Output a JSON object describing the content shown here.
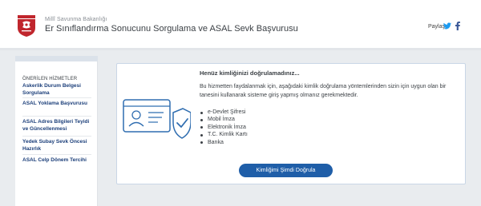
{
  "header": {
    "ministry": "Millî Savunma Bakanlığı",
    "service_title": "Er Sınıflandırma Sonucunu Sorgulama ve ASAL Sevk Başvurusu",
    "share_label": "Paylaş",
    "share_icons": [
      "twitter-icon",
      "facebook-icon"
    ]
  },
  "sidebar": {
    "heading": "ÖNERİLEN HİZMETLER",
    "items": [
      {
        "label": "Askerlik Durum Belgesi Sorgulama"
      },
      {
        "label": "ASAL Yoklama Başvurusu"
      },
      {
        "label": "ASAL Adres Bilgileri Teyidi ve Güncellenmesi"
      },
      {
        "label": "Yedek Subay Sevk Öncesi Hazırlık"
      },
      {
        "label": "ASAL Celp Dönem Tercihi"
      }
    ]
  },
  "notice": {
    "title": "Henüz kimliğinizi doğrulamadınız...",
    "description": "Bu hizmetten faydalanmak için, aşağıdaki kimlik doğrulama yöntemlerinden sizin için uygun olan bir tanesini kullanarak sisteme giriş yapmış olmanız gerekmektedir.",
    "methods": [
      "e-Devlet Şifresi",
      "Mobil İmza",
      "Elektronik İmza",
      "T.C. Kimlik Kartı",
      "Banka"
    ],
    "button_label": "Kimliğimi Şimdi Doğrula"
  },
  "colors": {
    "background": "#e9ecef",
    "link": "#1c3f7a",
    "button": "#1f5ea8",
    "logo_red": "#c0262d",
    "twitter": "#1d9bf0",
    "facebook": "#3b5998",
    "illustration": "#2f6db0"
  }
}
